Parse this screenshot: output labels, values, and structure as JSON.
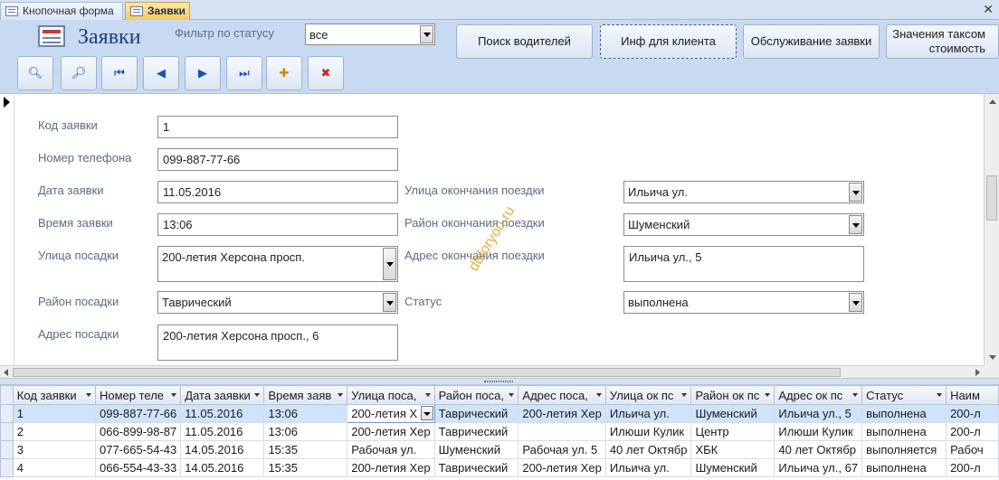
{
  "tabs": [
    {
      "label": "Кнопочная форма",
      "active": false
    },
    {
      "label": "Заявки",
      "active": true
    }
  ],
  "header": {
    "title": "Заявки",
    "filter_label": "Фильтр по статусу",
    "filter_value": "все",
    "buttons": {
      "find_drivers": "Поиск водителей",
      "client_info": "Инф для клиента",
      "service": "Обслуживание заявки",
      "tariff_line1": "Значения таксом",
      "tariff_line2": "стоимость"
    },
    "nav_icons": [
      "binoculars-icon",
      "find-next-icon",
      "first-record-icon",
      "previous-record-icon",
      "next-record-icon",
      "last-record-icon",
      "new-record-icon",
      "delete-record-icon"
    ]
  },
  "form": {
    "labels": {
      "id": "Код заявки",
      "phone": "Номер телефона",
      "date": "Дата заявки",
      "time": "Время заявки",
      "pickup_street": "Улица посадки",
      "pickup_district": "Район посадки",
      "pickup_address": "Адрес посадки",
      "end_street": "Улица окончания поездки",
      "end_district": "Район окончания поездки",
      "end_address": "Адрес окончания поездки",
      "status": "Статус"
    },
    "values": {
      "id": "1",
      "phone": "099-887-77-66",
      "date": "11.05.2016",
      "time": "13:06",
      "pickup_street": "200-летия Херсона просп.",
      "pickup_district": "Таврический",
      "pickup_address": "200-летия Херсона просп., 6",
      "end_street": "Ильича ул.",
      "end_district": "Шуменский",
      "end_address": "Ильича ул., 5",
      "status": "выполнена"
    },
    "watermark": "dbforyou.ru"
  },
  "grid": {
    "columns": [
      "Код заявки",
      "Номер теле",
      "Дата заявки",
      "Время заяв",
      "Улица поса,",
      "Район поса,",
      "Адрес поса,",
      "Улица ок пс",
      "Район ок пс",
      "Адрес ок пс",
      "Статус",
      "Наим"
    ],
    "rows": [
      [
        "1",
        "099-887-77-66",
        "11.05.2016",
        "13:06",
        "200-летия Х",
        "Таврический",
        "200-летия Хер",
        "Ильича ул.",
        "Шуменский",
        "Ильича ул., 5",
        "выполнена",
        "200-л"
      ],
      [
        "2",
        "066-899-98-87",
        "11.05.2016",
        "13:06",
        "200-летия Хер",
        "Таврический",
        "",
        "Илюши Кулик",
        "Центр",
        "Илюши Кулик",
        "выполнена",
        "200-л"
      ],
      [
        "3",
        "077-665-54-43",
        "14.05.2016",
        "15:35",
        "Рабочая ул.",
        "Шуменский",
        "Рабочая ул. 5",
        "40 лет Октябр",
        "ХБК",
        "40 лет Октябр",
        "выполняется",
        "Рабоч"
      ],
      [
        "4",
        "066-554-43-33",
        "14.05.2016",
        "15:35",
        "200-летия Хер",
        "Таврический",
        "200-летия Хер",
        "Ильича ул.",
        "Шуменский",
        "Ильича ул., 67",
        "выполнена",
        "200-л"
      ]
    ]
  }
}
